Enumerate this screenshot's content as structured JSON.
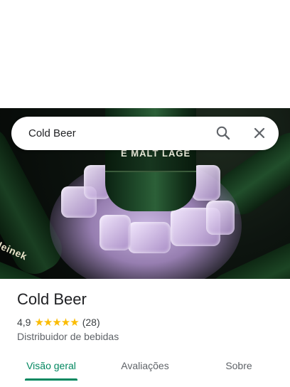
{
  "search": {
    "value": "Cold Beer"
  },
  "hero": {
    "bottle_label": "E MALT LAGE",
    "side_label": "Heinek"
  },
  "place": {
    "name": "Cold Beer",
    "rating": "4,9",
    "stars": "★★★★★",
    "review_count": "(28)",
    "category": "Distribuidor de bebidas"
  },
  "tabs": [
    {
      "label": "Visão geral",
      "active": true
    },
    {
      "label": "Avaliações",
      "active": false
    },
    {
      "label": "Sobre",
      "active": false
    }
  ],
  "colors": {
    "accent": "#01875f",
    "star": "#fbbc04",
    "text": "#202124",
    "secondary": "#5f6368"
  },
  "icons": {
    "search": "search-icon",
    "close": "close-icon"
  }
}
